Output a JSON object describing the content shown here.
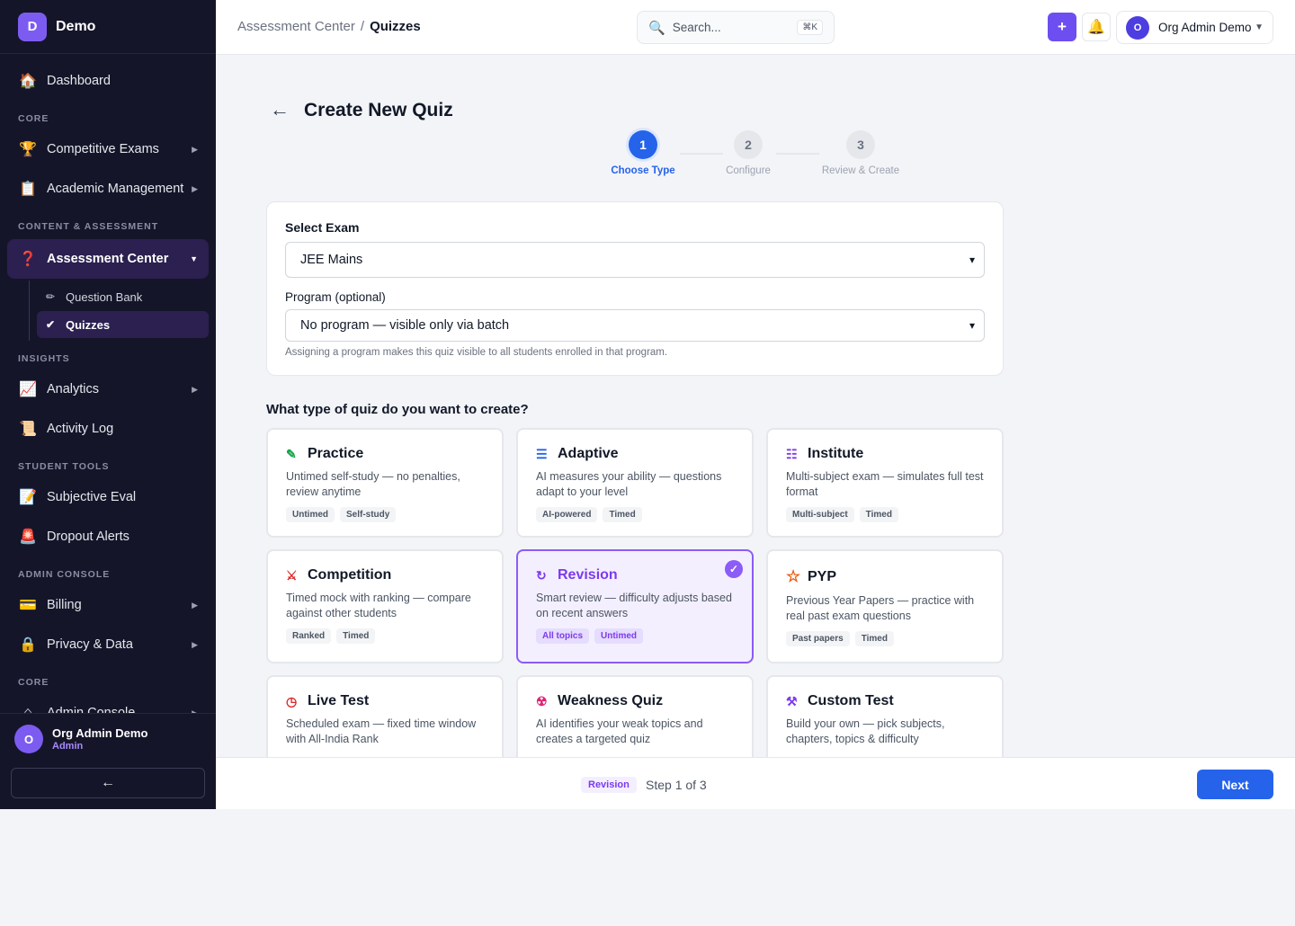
{
  "brand": {
    "logo_letter": "D",
    "name": "Demo"
  },
  "sidebar": {
    "dashboard": {
      "icon": "🏠",
      "label": "Dashboard"
    },
    "sections": {
      "core": "CORE",
      "content": "CONTENT & ASSESSMENT",
      "insights": "INSIGHTS",
      "student_tools": "STUDENT TOOLS",
      "admin_console": "ADMIN CONSOLE",
      "core2": "CORE"
    },
    "competitive_exams": {
      "icon": "🏆",
      "label": "Competitive Exams"
    },
    "academic": {
      "icon": "📋",
      "label": "Academic Management"
    },
    "assessment_center": {
      "icon": "❓",
      "label": "Assessment Center"
    },
    "question_bank": {
      "icon": "✏",
      "label": "Question Bank"
    },
    "quizzes": {
      "icon": "✔",
      "label": "Quizzes"
    },
    "analytics": {
      "icon": "📈",
      "label": "Analytics"
    },
    "activity_log": {
      "icon": "📜",
      "label": "Activity Log"
    },
    "subjective_eval": {
      "icon": "📝",
      "label": "Subjective Eval"
    },
    "dropout_alerts": {
      "icon": "🚨",
      "label": "Dropout Alerts"
    },
    "billing": {
      "icon": "💳",
      "label": "Billing"
    },
    "privacy": {
      "icon": "🔒",
      "label": "Privacy & Data"
    },
    "admin_console_item": {
      "icon": "⌂",
      "label": "Admin Console"
    },
    "user": {
      "initial": "O",
      "name": "Org Admin Demo",
      "role": "Admin"
    },
    "collapse_icon": "←"
  },
  "topbar": {
    "breadcrumb_parent": "Assessment Center",
    "breadcrumb_sep": "/",
    "breadcrumb_current": "Quizzes",
    "search_placeholder": "Search...",
    "search_shortcut": "⌘K",
    "plus_icon": "+",
    "bell_icon": "🔔",
    "user_initial": "O",
    "user_name": "Org Admin Demo",
    "user_dropdown_icon": "▼"
  },
  "page": {
    "back_icon": "←",
    "title": "Create New Quiz",
    "steps": [
      {
        "num": "1",
        "label": "Choose Type"
      },
      {
        "num": "2",
        "label": "Configure"
      },
      {
        "num": "3",
        "label": "Review & Create"
      }
    ],
    "exam_label": "Select Exam",
    "exam_value": "JEE Mains",
    "program_label": "Program (optional)",
    "program_value": "No program — visible only via batch",
    "program_hint": "Assigning a program makes this quiz visible to all students enrolled in that program.",
    "question": "What type of quiz do you want to create?",
    "selected_check": "✓"
  },
  "quiz_types": [
    {
      "icon": "✎",
      "title": "Practice",
      "desc": "Untimed self-study — no penalties, review anytime",
      "tags": [
        "Untimed",
        "Self-study"
      ]
    },
    {
      "icon": "☰",
      "title": "Adaptive",
      "desc": "AI measures your ability — questions adapt to your level",
      "tags": [
        "AI-powered",
        "Timed"
      ]
    },
    {
      "icon": "☷",
      "title": "Institute",
      "desc": "Multi-subject exam — simulates full test format",
      "tags": [
        "Multi-subject",
        "Timed"
      ]
    },
    {
      "icon": "⚔",
      "title": "Competition",
      "desc": "Timed mock with ranking — compare against other students",
      "tags": [
        "Ranked",
        "Timed"
      ]
    },
    {
      "icon": "↻",
      "title": "Revision",
      "desc": "Smart review — difficulty adjusts based on recent answers",
      "tags": [
        "All topics",
        "Untimed"
      ]
    },
    {
      "icon": "☆",
      "title": "PYP",
      "desc": "Previous Year Papers — practice with real past exam questions",
      "tags": [
        "Past papers",
        "Timed"
      ]
    },
    {
      "icon": "◷",
      "title": "Live Test",
      "desc": "Scheduled exam — fixed time window with All-India Rank",
      "tags": []
    },
    {
      "icon": "☢",
      "title": "Weakness Quiz",
      "desc": "AI identifies your weak topics and creates a targeted quiz",
      "tags": []
    },
    {
      "icon": "⚒",
      "title": "Custom Test",
      "desc": "Build your own — pick subjects, chapters, topics & difficulty",
      "tags": []
    }
  ],
  "footer": {
    "selected_type": "Revision",
    "step_text": "Step 1 of 3",
    "next_label": "Next"
  },
  "colors": {
    "accent": "#2563eb",
    "brand": "#7c5cf0",
    "selected": "#8b5cf6",
    "sidebar_bg": "#15152a"
  }
}
